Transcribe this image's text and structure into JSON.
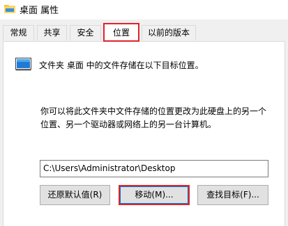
{
  "window": {
    "title": "桌面 属性"
  },
  "tabs": [
    {
      "label": "常规"
    },
    {
      "label": "共享"
    },
    {
      "label": "安全"
    },
    {
      "label": "位置",
      "active": true
    },
    {
      "label": "以前的版本"
    }
  ],
  "location": {
    "info": "文件夹 桌面 中的文件存储在以下目标位置。",
    "description_line1": "你可以将此文件夹中文件存储的位置更改为此硬盘上的另一个",
    "description_line2": "位置、另一个驱动器或网络上的另一台计算机。",
    "path": "C:\\Users\\Administrator\\Desktop"
  },
  "buttons": {
    "restore_default": "还原默认值(R)",
    "move": "移动(M)...",
    "find_target": "查找目标(F)..."
  },
  "colors": {
    "highlight": "#e0232a",
    "focus": "#0078d7",
    "folder": "#f4c542"
  }
}
